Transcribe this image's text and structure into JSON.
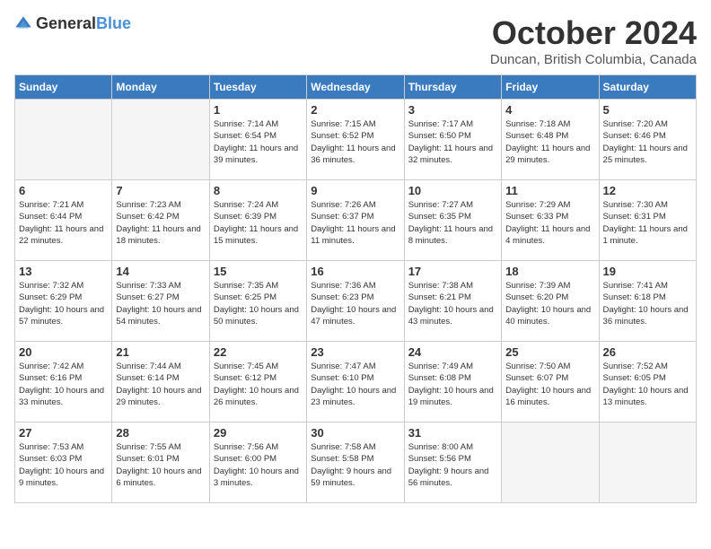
{
  "header": {
    "logo_general": "General",
    "logo_blue": "Blue",
    "month_title": "October 2024",
    "location": "Duncan, British Columbia, Canada"
  },
  "days_of_week": [
    "Sunday",
    "Monday",
    "Tuesday",
    "Wednesday",
    "Thursday",
    "Friday",
    "Saturday"
  ],
  "weeks": [
    [
      {
        "day": "",
        "empty": true
      },
      {
        "day": "",
        "empty": true
      },
      {
        "day": "1",
        "sunrise": "Sunrise: 7:14 AM",
        "sunset": "Sunset: 6:54 PM",
        "daylight": "Daylight: 11 hours and 39 minutes."
      },
      {
        "day": "2",
        "sunrise": "Sunrise: 7:15 AM",
        "sunset": "Sunset: 6:52 PM",
        "daylight": "Daylight: 11 hours and 36 minutes."
      },
      {
        "day": "3",
        "sunrise": "Sunrise: 7:17 AM",
        "sunset": "Sunset: 6:50 PM",
        "daylight": "Daylight: 11 hours and 32 minutes."
      },
      {
        "day": "4",
        "sunrise": "Sunrise: 7:18 AM",
        "sunset": "Sunset: 6:48 PM",
        "daylight": "Daylight: 11 hours and 29 minutes."
      },
      {
        "day": "5",
        "sunrise": "Sunrise: 7:20 AM",
        "sunset": "Sunset: 6:46 PM",
        "daylight": "Daylight: 11 hours and 25 minutes."
      }
    ],
    [
      {
        "day": "6",
        "sunrise": "Sunrise: 7:21 AM",
        "sunset": "Sunset: 6:44 PM",
        "daylight": "Daylight: 11 hours and 22 minutes."
      },
      {
        "day": "7",
        "sunrise": "Sunrise: 7:23 AM",
        "sunset": "Sunset: 6:42 PM",
        "daylight": "Daylight: 11 hours and 18 minutes."
      },
      {
        "day": "8",
        "sunrise": "Sunrise: 7:24 AM",
        "sunset": "Sunset: 6:39 PM",
        "daylight": "Daylight: 11 hours and 15 minutes."
      },
      {
        "day": "9",
        "sunrise": "Sunrise: 7:26 AM",
        "sunset": "Sunset: 6:37 PM",
        "daylight": "Daylight: 11 hours and 11 minutes."
      },
      {
        "day": "10",
        "sunrise": "Sunrise: 7:27 AM",
        "sunset": "Sunset: 6:35 PM",
        "daylight": "Daylight: 11 hours and 8 minutes."
      },
      {
        "day": "11",
        "sunrise": "Sunrise: 7:29 AM",
        "sunset": "Sunset: 6:33 PM",
        "daylight": "Daylight: 11 hours and 4 minutes."
      },
      {
        "day": "12",
        "sunrise": "Sunrise: 7:30 AM",
        "sunset": "Sunset: 6:31 PM",
        "daylight": "Daylight: 11 hours and 1 minute."
      }
    ],
    [
      {
        "day": "13",
        "sunrise": "Sunrise: 7:32 AM",
        "sunset": "Sunset: 6:29 PM",
        "daylight": "Daylight: 10 hours and 57 minutes."
      },
      {
        "day": "14",
        "sunrise": "Sunrise: 7:33 AM",
        "sunset": "Sunset: 6:27 PM",
        "daylight": "Daylight: 10 hours and 54 minutes."
      },
      {
        "day": "15",
        "sunrise": "Sunrise: 7:35 AM",
        "sunset": "Sunset: 6:25 PM",
        "daylight": "Daylight: 10 hours and 50 minutes."
      },
      {
        "day": "16",
        "sunrise": "Sunrise: 7:36 AM",
        "sunset": "Sunset: 6:23 PM",
        "daylight": "Daylight: 10 hours and 47 minutes."
      },
      {
        "day": "17",
        "sunrise": "Sunrise: 7:38 AM",
        "sunset": "Sunset: 6:21 PM",
        "daylight": "Daylight: 10 hours and 43 minutes."
      },
      {
        "day": "18",
        "sunrise": "Sunrise: 7:39 AM",
        "sunset": "Sunset: 6:20 PM",
        "daylight": "Daylight: 10 hours and 40 minutes."
      },
      {
        "day": "19",
        "sunrise": "Sunrise: 7:41 AM",
        "sunset": "Sunset: 6:18 PM",
        "daylight": "Daylight: 10 hours and 36 minutes."
      }
    ],
    [
      {
        "day": "20",
        "sunrise": "Sunrise: 7:42 AM",
        "sunset": "Sunset: 6:16 PM",
        "daylight": "Daylight: 10 hours and 33 minutes."
      },
      {
        "day": "21",
        "sunrise": "Sunrise: 7:44 AM",
        "sunset": "Sunset: 6:14 PM",
        "daylight": "Daylight: 10 hours and 29 minutes."
      },
      {
        "day": "22",
        "sunrise": "Sunrise: 7:45 AM",
        "sunset": "Sunset: 6:12 PM",
        "daylight": "Daylight: 10 hours and 26 minutes."
      },
      {
        "day": "23",
        "sunrise": "Sunrise: 7:47 AM",
        "sunset": "Sunset: 6:10 PM",
        "daylight": "Daylight: 10 hours and 23 minutes."
      },
      {
        "day": "24",
        "sunrise": "Sunrise: 7:49 AM",
        "sunset": "Sunset: 6:08 PM",
        "daylight": "Daylight: 10 hours and 19 minutes."
      },
      {
        "day": "25",
        "sunrise": "Sunrise: 7:50 AM",
        "sunset": "Sunset: 6:07 PM",
        "daylight": "Daylight: 10 hours and 16 minutes."
      },
      {
        "day": "26",
        "sunrise": "Sunrise: 7:52 AM",
        "sunset": "Sunset: 6:05 PM",
        "daylight": "Daylight: 10 hours and 13 minutes."
      }
    ],
    [
      {
        "day": "27",
        "sunrise": "Sunrise: 7:53 AM",
        "sunset": "Sunset: 6:03 PM",
        "daylight": "Daylight: 10 hours and 9 minutes."
      },
      {
        "day": "28",
        "sunrise": "Sunrise: 7:55 AM",
        "sunset": "Sunset: 6:01 PM",
        "daylight": "Daylight: 10 hours and 6 minutes."
      },
      {
        "day": "29",
        "sunrise": "Sunrise: 7:56 AM",
        "sunset": "Sunset: 6:00 PM",
        "daylight": "Daylight: 10 hours and 3 minutes."
      },
      {
        "day": "30",
        "sunrise": "Sunrise: 7:58 AM",
        "sunset": "Sunset: 5:58 PM",
        "daylight": "Daylight: 9 hours and 59 minutes."
      },
      {
        "day": "31",
        "sunrise": "Sunrise: 8:00 AM",
        "sunset": "Sunset: 5:56 PM",
        "daylight": "Daylight: 9 hours and 56 minutes."
      },
      {
        "day": "",
        "empty": true
      },
      {
        "day": "",
        "empty": true
      }
    ]
  ]
}
